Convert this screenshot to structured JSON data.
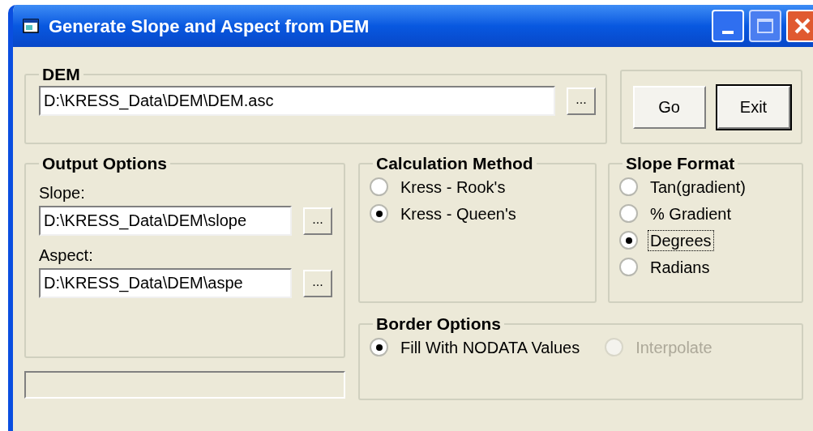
{
  "window": {
    "title": "Generate Slope and Aspect from DEM"
  },
  "dem": {
    "title": "DEM",
    "value": "D:\\KRESS_Data\\DEM\\DEM.asc",
    "browse": "..."
  },
  "actions": [
    {
      "label": "Go",
      "focused": false
    },
    {
      "label": "Exit",
      "focused": true
    }
  ],
  "output_options": {
    "title": "Output Options",
    "fields": [
      {
        "label": "Slope:",
        "value": "D:\\KRESS_Data\\DEM\\slope",
        "browse": "..."
      },
      {
        "label": "Aspect:",
        "value": "D:\\KRESS_Data\\DEM\\aspe",
        "browse": "..."
      }
    ]
  },
  "calculation_method": {
    "title": "Calculation Method",
    "options": [
      {
        "label": "Kress - Rook's",
        "selected": false
      },
      {
        "label": "Kress - Queen's",
        "selected": true
      }
    ]
  },
  "slope_format": {
    "title": "Slope Format",
    "options": [
      {
        "label": "Tan(gradient)",
        "selected": false,
        "focused": false
      },
      {
        "label": "% Gradient",
        "selected": false,
        "focused": false
      },
      {
        "label": "Degrees",
        "selected": true,
        "focused": true
      },
      {
        "label": "Radians",
        "selected": false,
        "focused": false
      }
    ]
  },
  "border_options": {
    "title": "Border Options",
    "options": [
      {
        "label": "Fill With NODATA Values",
        "selected": true,
        "disabled": false
      },
      {
        "label": "Interpolate",
        "selected": false,
        "disabled": true
      }
    ]
  }
}
